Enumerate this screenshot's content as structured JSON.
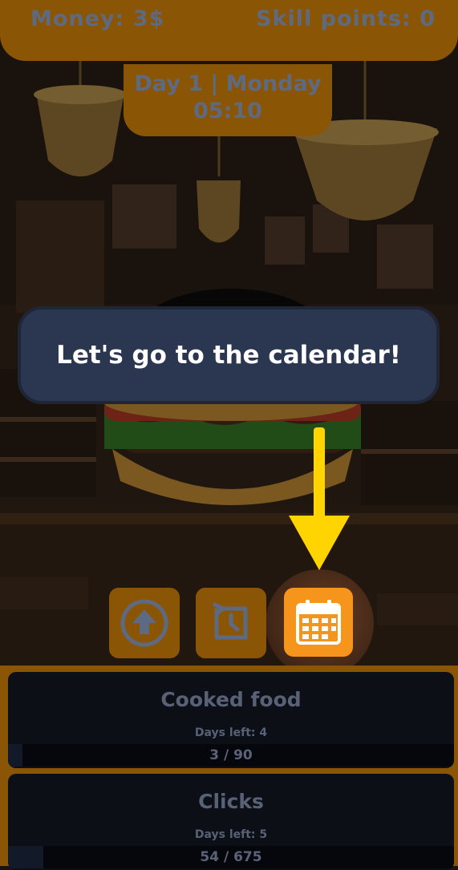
{
  "header": {
    "money": "Money: 3$",
    "skill_points": "Skill points: 0"
  },
  "day_panel": {
    "day_text": "Day 1 | Monday",
    "time": "05:10"
  },
  "tooltip": {
    "message": "Let's go to the calendar!"
  },
  "action_buttons": [
    {
      "icon": "upgrade-arrow-icon"
    },
    {
      "icon": "history-clock-icon"
    },
    {
      "icon": "calendar-icon",
      "highlighted": true
    }
  ],
  "goals": [
    {
      "title": "Cooked food",
      "days_left": "Days left: 4",
      "progress_text": "3 / 90",
      "progress": 0.033
    },
    {
      "title": "Clicks",
      "days_left": "Days left: 5",
      "progress_text": "54 / 675",
      "progress": 0.08
    }
  ],
  "colors": {
    "panel": "#8a5606",
    "highlight_button": "#f5951b",
    "tooltip_bg": "#2b3650",
    "arrow": "#ffd400"
  }
}
